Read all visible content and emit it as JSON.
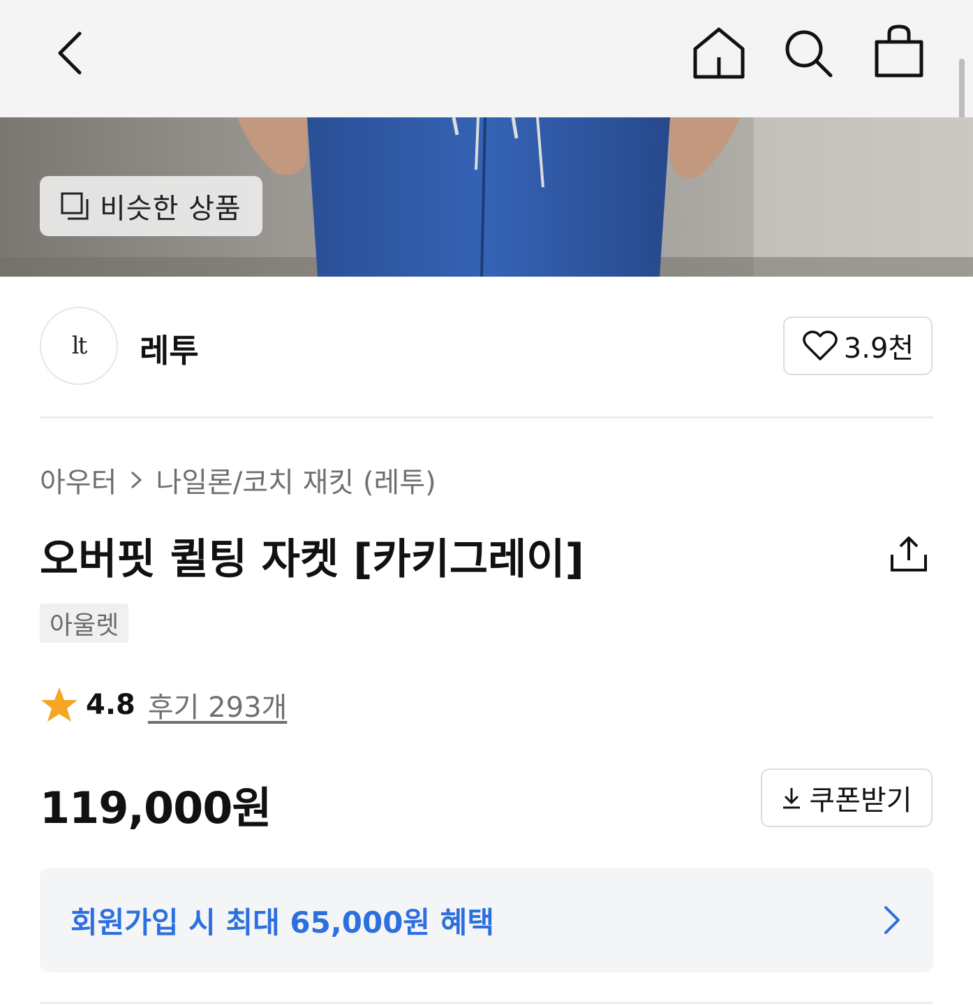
{
  "topbar": {
    "icons": [
      "back-icon",
      "home-icon",
      "search-icon",
      "shopping-bag-icon"
    ]
  },
  "hero": {
    "similar_products_label": "비슷한 상품"
  },
  "brand": {
    "logo_text": "lt",
    "name": "레투",
    "like_count": "3.9천"
  },
  "breadcrumb": {
    "category": "아우터",
    "subcategory": "나일론/코치 재킷 (레투)"
  },
  "product": {
    "title": "오버핏 퀼팅 자켓 [카키그레이]",
    "badge": "아울렛",
    "rating": "4.8",
    "reviews": "후기 293개",
    "price": "119,000원"
  },
  "coupon": {
    "label": "쿠폰받기"
  },
  "benefit": {
    "text": "회원가입 시 최대 65,000원 혜택"
  },
  "colors": {
    "accent_blue": "#2c6fe0",
    "star": "#f5a623",
    "topbar_bg": "#f4f4f4"
  }
}
